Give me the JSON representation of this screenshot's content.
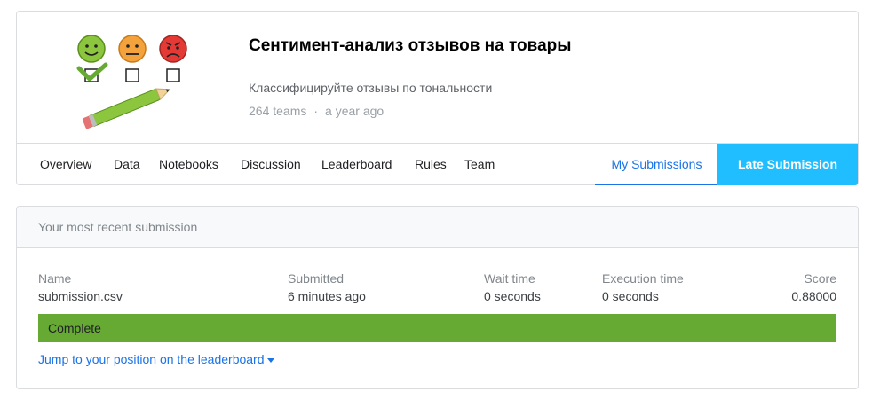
{
  "competition": {
    "title": "Сентимент-анализ отзывов на товары",
    "subtitle": "Классифицируйте отзывы по тональности",
    "teams": "264 teams",
    "separator": "·",
    "age": "a year ago"
  },
  "tabs": [
    {
      "label": "Overview"
    },
    {
      "label": "Data"
    },
    {
      "label": "Notebooks"
    },
    {
      "label": "Discussion"
    },
    {
      "label": "Leaderboard"
    },
    {
      "label": "Rules"
    },
    {
      "label": "Team"
    }
  ],
  "active_tab": "My Submissions",
  "late_submission": "Late Submission",
  "submission": {
    "header": "Your most recent submission",
    "columns": {
      "name": {
        "label": "Name",
        "value": "submission.csv"
      },
      "submitted": {
        "label": "Submitted",
        "value": "6 minutes ago"
      },
      "wait": {
        "label": "Wait time",
        "value": "0 seconds"
      },
      "execution": {
        "label": "Execution time",
        "value": "0 seconds"
      },
      "score": {
        "label": "Score",
        "value": "0.88000"
      }
    },
    "status": "Complete",
    "status_color": "#66aa33",
    "jump_link": "Jump to your position on the leaderboard"
  },
  "colors": {
    "accent": "#20beff",
    "link": "#1a73e8"
  },
  "icons": [
    "sentiment-logo",
    "chevron-down-icon"
  ]
}
